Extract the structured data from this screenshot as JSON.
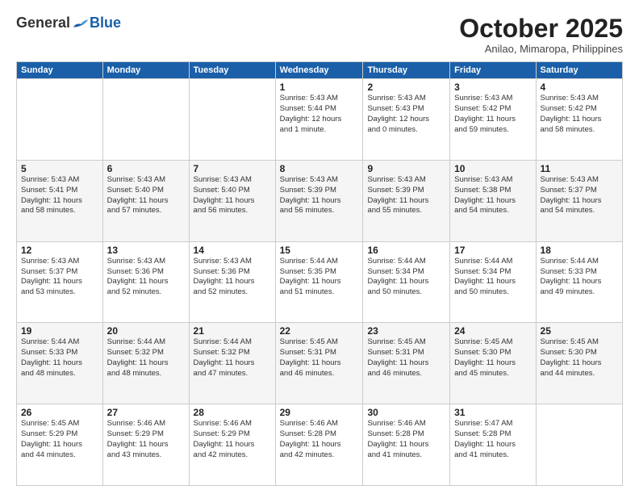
{
  "header": {
    "logo_general": "General",
    "logo_blue": "Blue",
    "month": "October 2025",
    "location": "Anilao, Mimaropa, Philippines"
  },
  "days_of_week": [
    "Sunday",
    "Monday",
    "Tuesday",
    "Wednesday",
    "Thursday",
    "Friday",
    "Saturday"
  ],
  "weeks": [
    [
      {
        "day": "",
        "info": ""
      },
      {
        "day": "",
        "info": ""
      },
      {
        "day": "",
        "info": ""
      },
      {
        "day": "1",
        "info": "Sunrise: 5:43 AM\nSunset: 5:44 PM\nDaylight: 12 hours\nand 1 minute."
      },
      {
        "day": "2",
        "info": "Sunrise: 5:43 AM\nSunset: 5:43 PM\nDaylight: 12 hours\nand 0 minutes."
      },
      {
        "day": "3",
        "info": "Sunrise: 5:43 AM\nSunset: 5:42 PM\nDaylight: 11 hours\nand 59 minutes."
      },
      {
        "day": "4",
        "info": "Sunrise: 5:43 AM\nSunset: 5:42 PM\nDaylight: 11 hours\nand 58 minutes."
      }
    ],
    [
      {
        "day": "5",
        "info": "Sunrise: 5:43 AM\nSunset: 5:41 PM\nDaylight: 11 hours\nand 58 minutes."
      },
      {
        "day": "6",
        "info": "Sunrise: 5:43 AM\nSunset: 5:40 PM\nDaylight: 11 hours\nand 57 minutes."
      },
      {
        "day": "7",
        "info": "Sunrise: 5:43 AM\nSunset: 5:40 PM\nDaylight: 11 hours\nand 56 minutes."
      },
      {
        "day": "8",
        "info": "Sunrise: 5:43 AM\nSunset: 5:39 PM\nDaylight: 11 hours\nand 56 minutes."
      },
      {
        "day": "9",
        "info": "Sunrise: 5:43 AM\nSunset: 5:39 PM\nDaylight: 11 hours\nand 55 minutes."
      },
      {
        "day": "10",
        "info": "Sunrise: 5:43 AM\nSunset: 5:38 PM\nDaylight: 11 hours\nand 54 minutes."
      },
      {
        "day": "11",
        "info": "Sunrise: 5:43 AM\nSunset: 5:37 PM\nDaylight: 11 hours\nand 54 minutes."
      }
    ],
    [
      {
        "day": "12",
        "info": "Sunrise: 5:43 AM\nSunset: 5:37 PM\nDaylight: 11 hours\nand 53 minutes."
      },
      {
        "day": "13",
        "info": "Sunrise: 5:43 AM\nSunset: 5:36 PM\nDaylight: 11 hours\nand 52 minutes."
      },
      {
        "day": "14",
        "info": "Sunrise: 5:43 AM\nSunset: 5:36 PM\nDaylight: 11 hours\nand 52 minutes."
      },
      {
        "day": "15",
        "info": "Sunrise: 5:44 AM\nSunset: 5:35 PM\nDaylight: 11 hours\nand 51 minutes."
      },
      {
        "day": "16",
        "info": "Sunrise: 5:44 AM\nSunset: 5:34 PM\nDaylight: 11 hours\nand 50 minutes."
      },
      {
        "day": "17",
        "info": "Sunrise: 5:44 AM\nSunset: 5:34 PM\nDaylight: 11 hours\nand 50 minutes."
      },
      {
        "day": "18",
        "info": "Sunrise: 5:44 AM\nSunset: 5:33 PM\nDaylight: 11 hours\nand 49 minutes."
      }
    ],
    [
      {
        "day": "19",
        "info": "Sunrise: 5:44 AM\nSunset: 5:33 PM\nDaylight: 11 hours\nand 48 minutes."
      },
      {
        "day": "20",
        "info": "Sunrise: 5:44 AM\nSunset: 5:32 PM\nDaylight: 11 hours\nand 48 minutes."
      },
      {
        "day": "21",
        "info": "Sunrise: 5:44 AM\nSunset: 5:32 PM\nDaylight: 11 hours\nand 47 minutes."
      },
      {
        "day": "22",
        "info": "Sunrise: 5:45 AM\nSunset: 5:31 PM\nDaylight: 11 hours\nand 46 minutes."
      },
      {
        "day": "23",
        "info": "Sunrise: 5:45 AM\nSunset: 5:31 PM\nDaylight: 11 hours\nand 46 minutes."
      },
      {
        "day": "24",
        "info": "Sunrise: 5:45 AM\nSunset: 5:30 PM\nDaylight: 11 hours\nand 45 minutes."
      },
      {
        "day": "25",
        "info": "Sunrise: 5:45 AM\nSunset: 5:30 PM\nDaylight: 11 hours\nand 44 minutes."
      }
    ],
    [
      {
        "day": "26",
        "info": "Sunrise: 5:45 AM\nSunset: 5:29 PM\nDaylight: 11 hours\nand 44 minutes."
      },
      {
        "day": "27",
        "info": "Sunrise: 5:46 AM\nSunset: 5:29 PM\nDaylight: 11 hours\nand 43 minutes."
      },
      {
        "day": "28",
        "info": "Sunrise: 5:46 AM\nSunset: 5:29 PM\nDaylight: 11 hours\nand 42 minutes."
      },
      {
        "day": "29",
        "info": "Sunrise: 5:46 AM\nSunset: 5:28 PM\nDaylight: 11 hours\nand 42 minutes."
      },
      {
        "day": "30",
        "info": "Sunrise: 5:46 AM\nSunset: 5:28 PM\nDaylight: 11 hours\nand 41 minutes."
      },
      {
        "day": "31",
        "info": "Sunrise: 5:47 AM\nSunset: 5:28 PM\nDaylight: 11 hours\nand 41 minutes."
      },
      {
        "day": "",
        "info": ""
      }
    ]
  ]
}
